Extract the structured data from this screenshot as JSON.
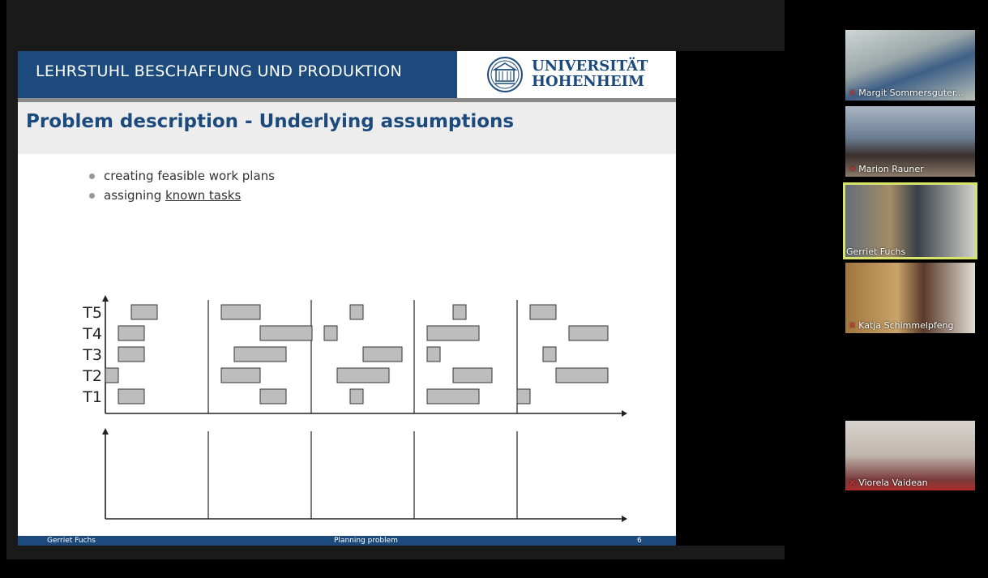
{
  "slide": {
    "header": "LEHRSTUHL BESCHAFFUNG UND PRODUKTION",
    "logo_line1": "UNIVERSITÄT",
    "logo_line2": "HOHENHEIM",
    "title": "Problem description - Underlying assumptions",
    "bullet1": "creating feasible work plans",
    "bullet2_prefix": "assigning ",
    "bullet2_underlined": "known tasks",
    "footer_left": "Gerriet Fuchs",
    "footer_center": "Planning problem",
    "footer_right": "6"
  },
  "chart_data": {
    "type": "gantt",
    "tasks": [
      "T5",
      "T4",
      "T3",
      "T2",
      "T1"
    ],
    "periods": 5,
    "schedules": [
      {
        "T5": [
          [
            1.0,
            2.0
          ]
        ],
        "T4": [
          [
            0.5,
            1.5
          ]
        ],
        "T3": [
          [
            0.5,
            1.5
          ]
        ],
        "T2": [
          [
            0.0,
            0.5
          ]
        ],
        "T1": [
          [
            0.5,
            1.5
          ]
        ]
      },
      {
        "T5": [
          [
            0.5,
            2.0
          ]
        ],
        "T4": [
          [
            2.0,
            4.0
          ]
        ],
        "T3": [
          [
            1.0,
            3.0
          ]
        ],
        "T2": [
          [
            0.5,
            2.0
          ]
        ],
        "T1": [
          [
            2.0,
            3.0
          ]
        ]
      },
      {
        "T5": [
          [
            1.5,
            2.0
          ]
        ],
        "T4": [
          [
            0.5,
            1.0
          ]
        ],
        "T3": [
          [
            2.0,
            3.5
          ]
        ],
        "T2": [
          [
            1.0,
            3.0
          ]
        ],
        "T1": [
          [
            1.5,
            2.0
          ]
        ]
      },
      {
        "T5": [
          [
            1.5,
            2.0
          ]
        ],
        "T4": [
          [
            0.5,
            2.5
          ]
        ],
        "T3": [
          [
            0.5,
            1.0
          ]
        ],
        "T2": [
          [
            1.5,
            3.0
          ]
        ],
        "T1": [
          [
            0.5,
            2.5
          ]
        ]
      },
      {
        "T5": [
          [
            0.5,
            1.5
          ]
        ],
        "T4": [
          [
            2.0,
            3.5
          ]
        ],
        "T3": [
          [
            1.0,
            1.5
          ]
        ],
        "T2": [
          [
            1.5,
            3.5
          ]
        ],
        "T1": [
          [
            0.0,
            0.5
          ]
        ]
      }
    ]
  },
  "participants": [
    {
      "name": "Margit Sommersguter...",
      "muted": true
    },
    {
      "name": "Marion Rauner",
      "muted": true
    },
    {
      "name": "Gerriet Fuchs",
      "muted": false,
      "active": true
    },
    {
      "name": "Katja Schimmelpfeng",
      "muted": true
    },
    {
      "name": "Viorela Vaidean",
      "muted": true
    }
  ],
  "colors": {
    "brand": "#1c4a7c",
    "bar_fill": "#bdbdbd",
    "active_speaker": "#d7e36a",
    "mic_muted": "#e53935"
  },
  "icons": {
    "muted": "mic-muted-icon"
  }
}
